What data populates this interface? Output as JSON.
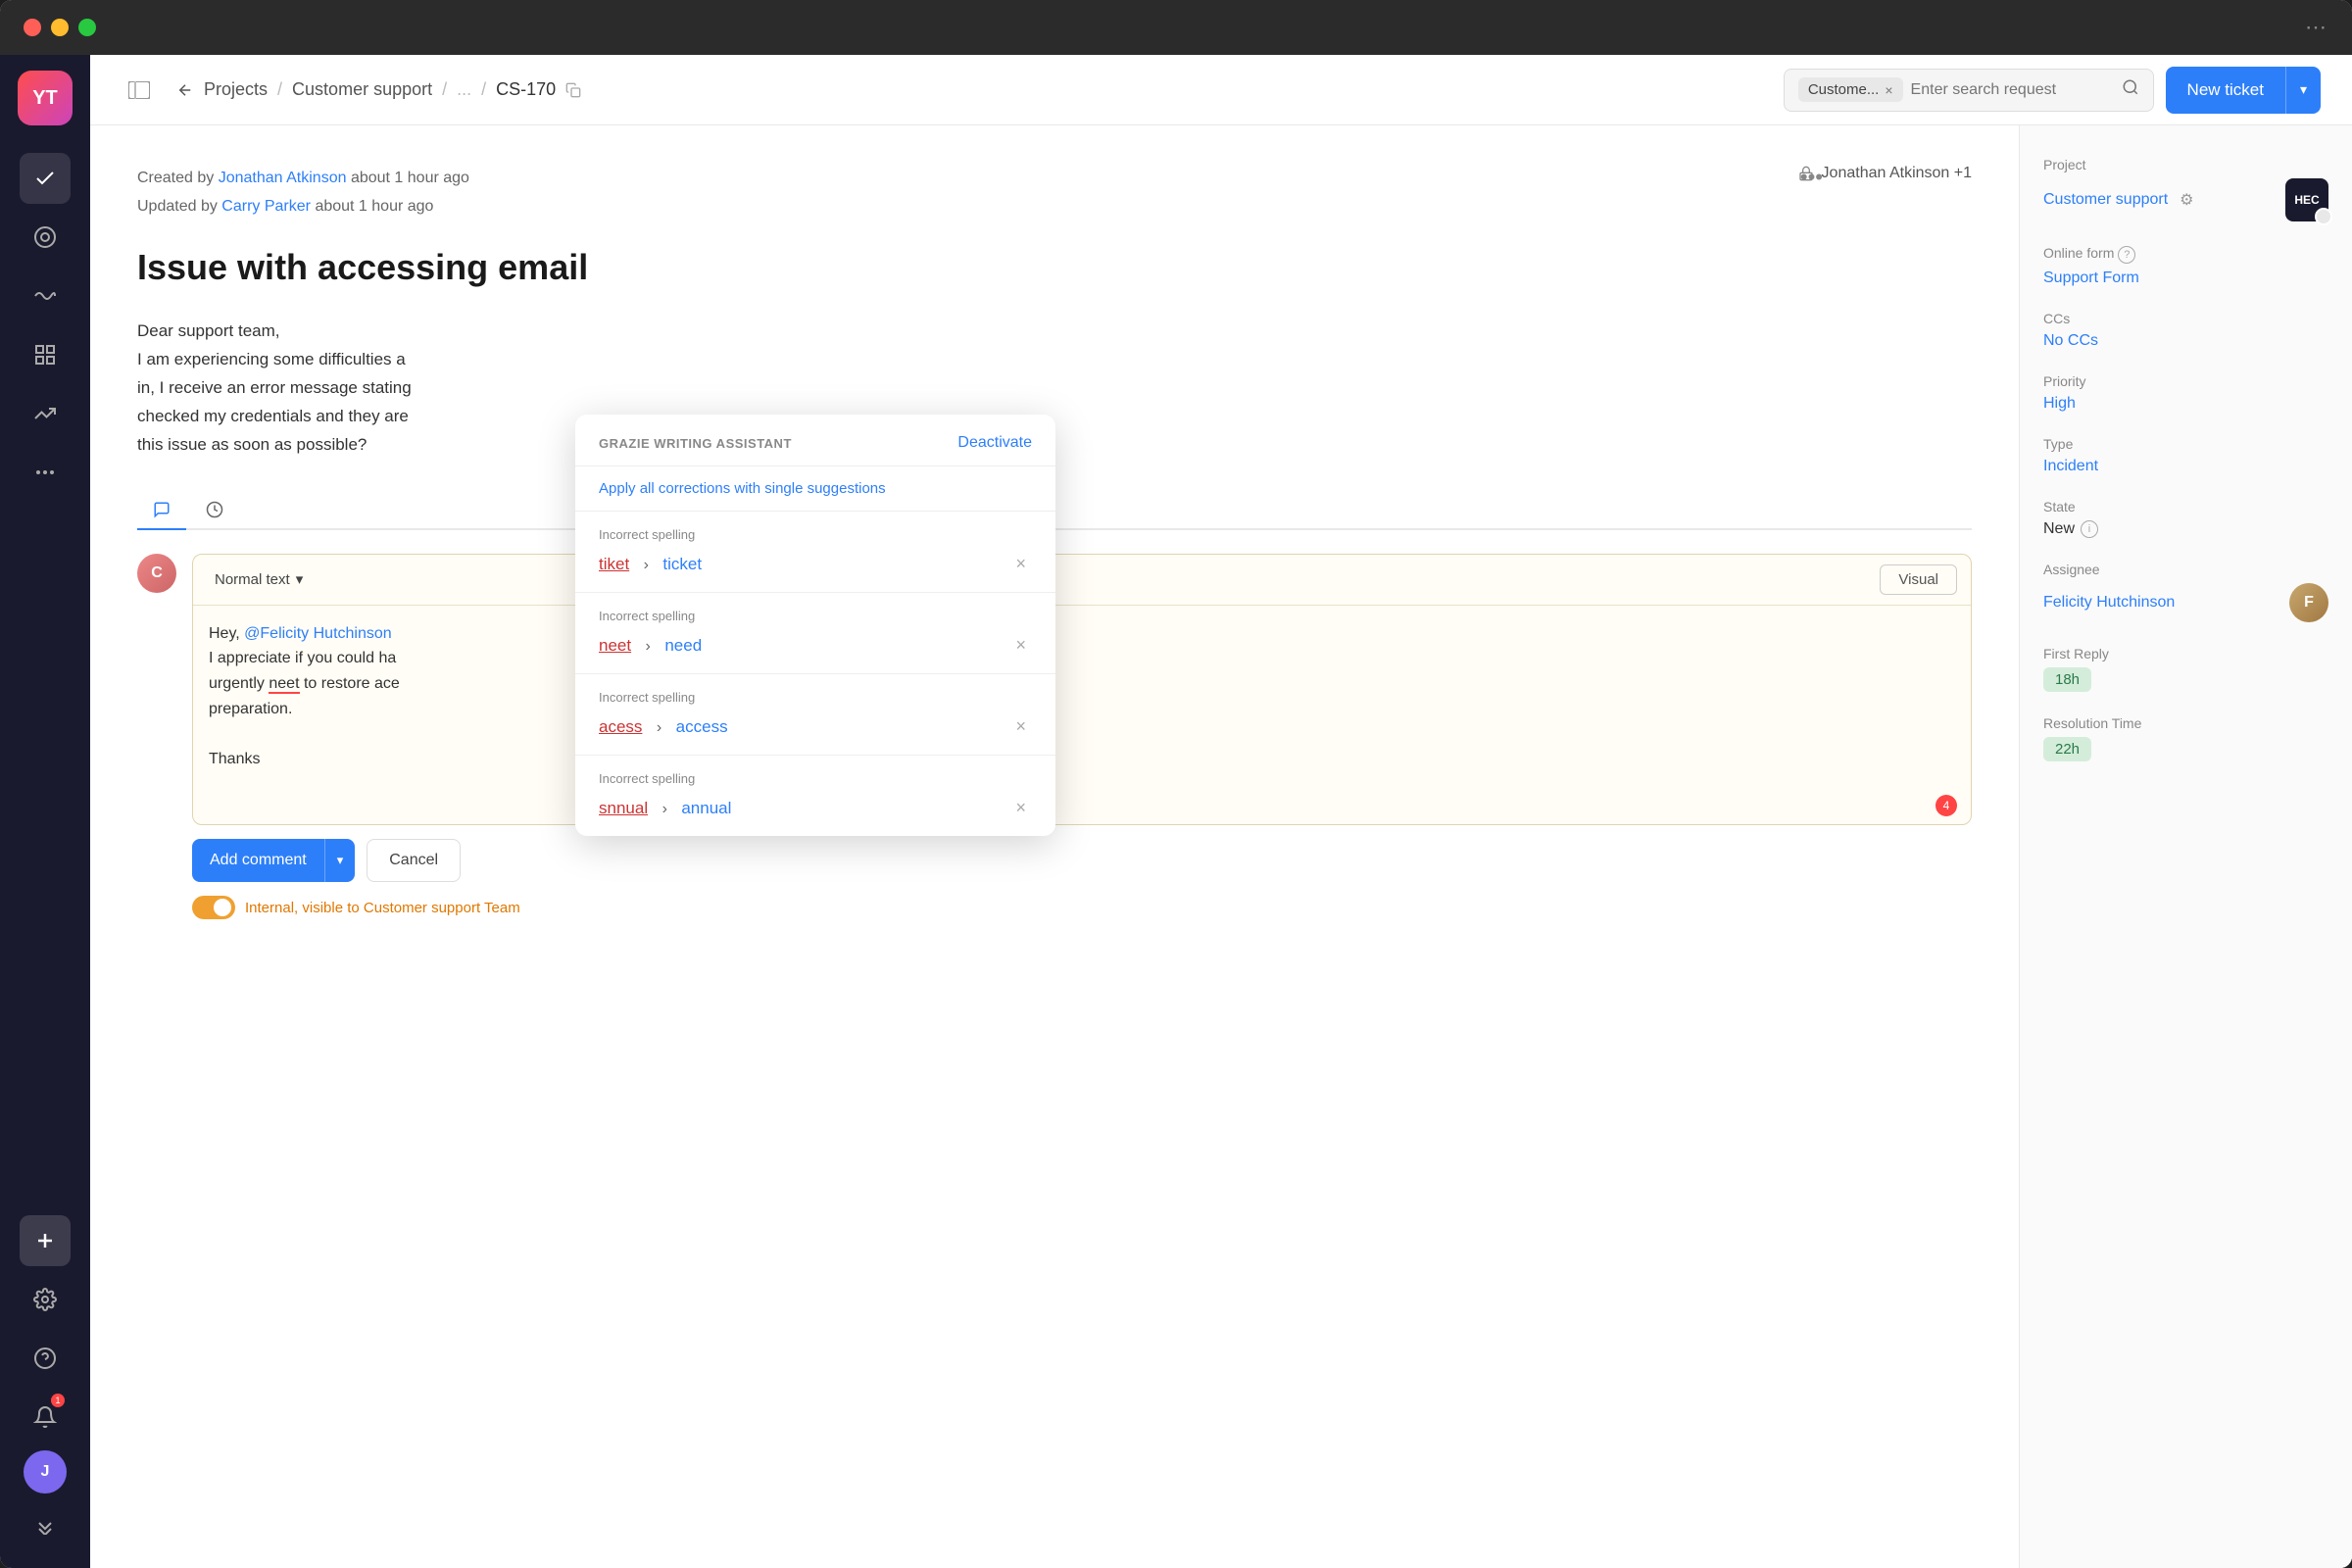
{
  "window": {
    "titlebar": {
      "dots": [
        "red",
        "yellow",
        "green"
      ]
    }
  },
  "topbar": {
    "breadcrumb": {
      "projects": "Projects",
      "project": "Customer support",
      "ellipsis": "...",
      "ticket": "CS-170"
    },
    "search": {
      "chip": "Custome...",
      "placeholder": "Enter search request"
    },
    "new_ticket_label": "New ticket"
  },
  "ticket": {
    "meta": {
      "created_by_prefix": "Created by",
      "created_by": "Jonathan Atkinson",
      "created_ago": "about 1 hour ago",
      "updated_by_prefix": "Updated by",
      "updated_by": "Carry Parker",
      "updated_ago": "about 1 hour ago",
      "lock_user": "Jonathan Atkinson +1"
    },
    "title": "Issue with accessing email",
    "body_line1": "Dear support team,",
    "body_line2": "I am experiencing some difficulties a",
    "body_line3": "in, I receive an error message stating",
    "body_line4": "checked my credentials and they are",
    "body_line5": "this issue as soon as possible?"
  },
  "tabs": {
    "comment_icon": "💬",
    "history_icon": "🕐"
  },
  "editor": {
    "format_label": "Normal text",
    "visual_label": "Visual",
    "content_line1": "Hey,",
    "mention": "@Felicity Hutchinson",
    "content_line2": "I appreciate if you could ha",
    "content_line3": "urgently",
    "misspelled1": "neet",
    "content_line4": "to restore ace",
    "content_line5": "preparation.",
    "content_line6": "Thanks",
    "char_count": "4"
  },
  "actions": {
    "add_comment": "Add comment",
    "cancel": "Cancel",
    "internal_toggle": "Internal, visible to Customer support Team"
  },
  "sidebar": {
    "project_label": "Project",
    "project_value": "Customer support",
    "project_logo": "HEC",
    "online_form_label": "Online form",
    "online_form_value": "Support Form",
    "ccs_label": "CCs",
    "ccs_value": "No CCs",
    "priority_label": "Priority",
    "priority_value": "High",
    "type_label": "Type",
    "type_value": "Incident",
    "state_label": "State",
    "state_value": "New",
    "assignee_label": "Assignee",
    "assignee_value": "Felicity Hutchinson",
    "first_reply_label": "First Reply",
    "first_reply_value": "18h",
    "resolution_label": "Resolution Time",
    "resolution_value": "22h"
  },
  "grazie": {
    "title": "GRAZIE WRITING ASSISTANT",
    "deactivate": "Deactivate",
    "apply_all": "Apply all corrections with single suggestions",
    "items": [
      {
        "label": "Incorrect spelling",
        "from": "tiket",
        "to": "ticket"
      },
      {
        "label": "Incorrect spelling",
        "from": "neet",
        "to": "need"
      },
      {
        "label": "Incorrect spelling",
        "from": "acess",
        "to": "access"
      },
      {
        "label": "Incorrect spelling",
        "from": "snnual",
        "to": "annual"
      }
    ]
  },
  "sidebar_icons": {
    "check": "✓",
    "target": "◎",
    "wave": "〜",
    "grid": "⊞",
    "chart": "↗",
    "dots": "•••",
    "plus": "+",
    "gear": "⚙",
    "question": "?",
    "bell": "�bell",
    "chevron_down": "⌄⌄"
  }
}
